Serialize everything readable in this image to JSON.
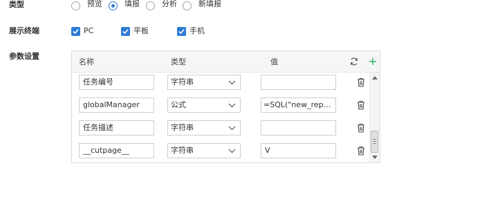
{
  "type_setting": {
    "label": "类型",
    "options": [
      {
        "label": "预览",
        "checked": false
      },
      {
        "label": "填报",
        "checked": true
      },
      {
        "label": "分析",
        "checked": false
      },
      {
        "label": "新填报",
        "checked": false
      }
    ]
  },
  "terminal_setting": {
    "label": "展示终端",
    "options": [
      {
        "label": "PC",
        "checked": true
      },
      {
        "label": "平板",
        "checked": true
      },
      {
        "label": "手机",
        "checked": true
      }
    ]
  },
  "param_setting": {
    "label": "参数设置",
    "columns": {
      "name": "名称",
      "type": "类型",
      "value": "值"
    },
    "icons": {
      "refresh": "refresh-icon",
      "add": "plus-icon",
      "delete": "trash-icon"
    },
    "rows": [
      {
        "name": "任务编号",
        "type": "字符串",
        "value": ""
      },
      {
        "name": "globalManager",
        "type": "公式",
        "value": "=SQL(\"new_report..."
      },
      {
        "name": "任务描述",
        "type": "字符串",
        "value": ""
      },
      {
        "name": "__cutpage__",
        "type": "字符串",
        "value": "V"
      }
    ]
  },
  "colors": {
    "accent": "#2d7cd6",
    "add_green": "#34b36a"
  }
}
